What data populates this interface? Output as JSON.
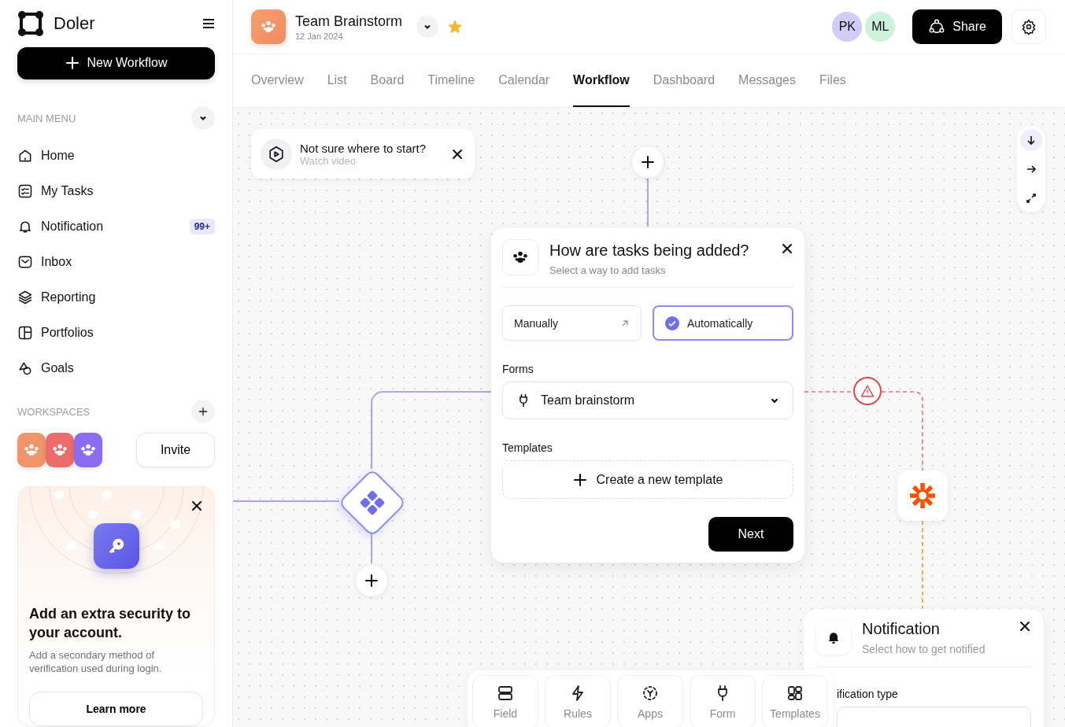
{
  "sidebar": {
    "brand": "Doler",
    "new_workflow": "New Workflow",
    "main_menu_label": "MAIN MENU",
    "menu": [
      {
        "label": "Home",
        "kind": "home"
      },
      {
        "label": "My Tasks",
        "kind": "tasks"
      },
      {
        "label": "Notification",
        "kind": "bell",
        "badge": "99+"
      },
      {
        "label": "Inbox",
        "kind": "inbox"
      },
      {
        "label": "Reporting",
        "kind": "layers"
      },
      {
        "label": "Portfolios",
        "kind": "grid"
      },
      {
        "label": "Goals",
        "kind": "shapes"
      }
    ],
    "workspaces_label": "WORKSPACES",
    "workspaces": [
      {
        "color": "#f0956a"
      },
      {
        "color": "#ec6b6b"
      },
      {
        "color": "#8b6cf0"
      }
    ],
    "invite": "Invite",
    "security_card": {
      "title": "Add an extra security to your account.",
      "body": "Add a secondary method of verification used during login.",
      "button": "Learn more"
    }
  },
  "header": {
    "project": "Team Brainstorm",
    "date": "12 Jan 2024",
    "starred": true,
    "avatars": [
      {
        "initials": "PK",
        "color": "#cfcdf6"
      },
      {
        "initials": "ML",
        "color": "#cdf3da"
      }
    ],
    "share": "Share"
  },
  "tabs": [
    {
      "label": "Overview",
      "selected": false
    },
    {
      "label": "List",
      "selected": false
    },
    {
      "label": "Board",
      "selected": false
    },
    {
      "label": "Timeline",
      "selected": false
    },
    {
      "label": "Calendar",
      "selected": false
    },
    {
      "label": "Workflow",
      "selected": true
    },
    {
      "label": "Dashboard",
      "selected": false
    },
    {
      "label": "Messages",
      "selected": false
    },
    {
      "label": "Files",
      "selected": false
    }
  ],
  "canvas": {
    "hint": {
      "title": "Not sure where to start?",
      "subtitle": "Watch video"
    },
    "modal": {
      "title": "How are tasks being added?",
      "subtitle": "Select a way to add tasks",
      "options": [
        {
          "label": "Manually",
          "selected": false
        },
        {
          "label": "Automatically",
          "selected": true
        }
      ],
      "forms_label": "Forms",
      "forms_value": "Team brainstorm",
      "templates_label": "Templates",
      "create_template": "Create a new template",
      "next": "Next"
    },
    "notification": {
      "title": "Notification",
      "subtitle": "Select how to get notified",
      "type_label": "ification type"
    },
    "toolbar": [
      {
        "label": "Field",
        "kind": "field"
      },
      {
        "label": "Rules",
        "kind": "rules"
      },
      {
        "label": "Apps",
        "kind": "apps"
      },
      {
        "label": "Form",
        "kind": "form"
      },
      {
        "label": "Templates",
        "kind": "templates"
      }
    ]
  }
}
